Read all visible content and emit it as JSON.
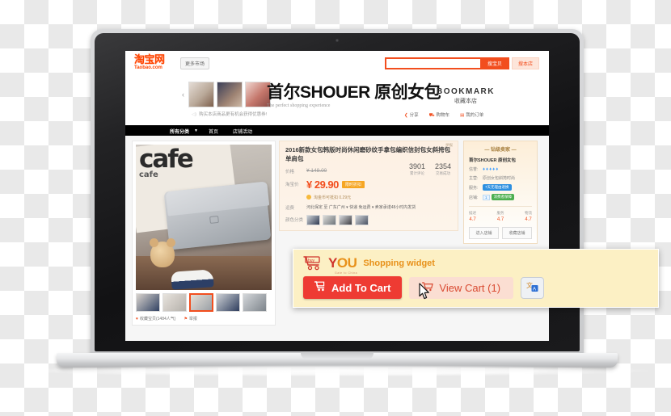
{
  "taobao": {
    "logo_cn": "淘宝网",
    "logo_en": "Taobao.com",
    "more_market": "更多市场",
    "search_placeholder": "",
    "search_value": "",
    "btn_search_item": "搜宝贝",
    "btn_search_shop": "搜本店",
    "carousel": {
      "prev": "‹",
      "next": "›",
      "thumbs": [
        "bag-thumb-1",
        "bag-thumb-2",
        "bag-thumb-3"
      ]
    },
    "shop_title": "首尔SHOUER 原创女包",
    "shop_subtitle": "The perfect shopping experience",
    "bookmark_en": "BOOKMARK",
    "bookmark_cn": "收藏本店",
    "mini_links": [
      {
        "icon": "share-icon",
        "glyph": "❮",
        "label": "分享"
      },
      {
        "icon": "cart-icon",
        "glyph": "⛟",
        "label": "购物车"
      },
      {
        "icon": "order-icon",
        "glyph": "▤",
        "label": "我的订单"
      }
    ],
    "notice": "购买本店商品更有机会获得优惠券!",
    "nav": [
      {
        "label": "所有分类",
        "caret": "▼"
      },
      {
        "label": "首页"
      },
      {
        "label": "店铺活动"
      }
    ]
  },
  "product": {
    "report_label": "举报",
    "title": "2016新款女包韩版时尚休闲磨砂纹手拿包编织信封包女斜挎包单肩包",
    "price_label": "价格",
    "old_price": "¥ 149.00",
    "taobao_price_label": "淘宝价",
    "new_price": "¥ 29.90",
    "promo_tag": "限时折扣",
    "coin_text": "淘金币可抵扣 0.29元",
    "stats": [
      {
        "num": "3901",
        "cap": "累计评论"
      },
      {
        "num": "2354",
        "cap": "交易成功"
      }
    ],
    "ship_label": "运费",
    "ship_text": "河北保定 至 广东广州 ▾   快递 免运费 ▾   卖家承诺48小时内发货",
    "color_label": "颜色分类",
    "gallery_foot": [
      {
        "icon": "heart-icon",
        "label": "收藏宝贝(1484人气)"
      },
      {
        "icon": "report-flag-icon",
        "label": "举报"
      }
    ],
    "thumb_selected_index": 2
  },
  "seller": {
    "header": "— 钻级卖家 —",
    "name": "首尔SHOUER 原创女包",
    "rows": [
      {
        "key": "信誉:",
        "value": "♦♦♦♦♦",
        "type": "hearts"
      },
      {
        "key": "主营:",
        "value": "原创女包斜挎时尚",
        "type": "text"
      },
      {
        "key": "服务:",
        "value": "7天无理由退换",
        "type": "badge-blue"
      },
      {
        "key": "店铺:",
        "value": "消费者保障",
        "type": "badge-green"
      }
    ],
    "rates": [
      {
        "k": "描述",
        "v": "4.7",
        "mark": "●"
      },
      {
        "k": "服务",
        "v": "4.7",
        "mark": "●"
      },
      {
        "k": "物流",
        "v": "4.7",
        "mark": "●"
      }
    ],
    "buttons": [
      "进入店铺",
      "收藏店铺"
    ]
  },
  "widget": {
    "brand_buy": "buy",
    "brand_y": "Y",
    "brand_ou": "OU",
    "tagline": "Shopping widget",
    "sub_tagline": "Gate to China",
    "add_to_cart": "Add To Cart",
    "view_cart": "View Cart (1)",
    "cart_count": 1,
    "translate_icon": "translate-icon",
    "colors": {
      "panel": "#fcf0c4",
      "add_button": "#ee3b33",
      "view_button": "#fbded2",
      "view_text": "#d94a32",
      "brand_y": "#d0342c",
      "brand_ou": "#e8911a"
    }
  }
}
